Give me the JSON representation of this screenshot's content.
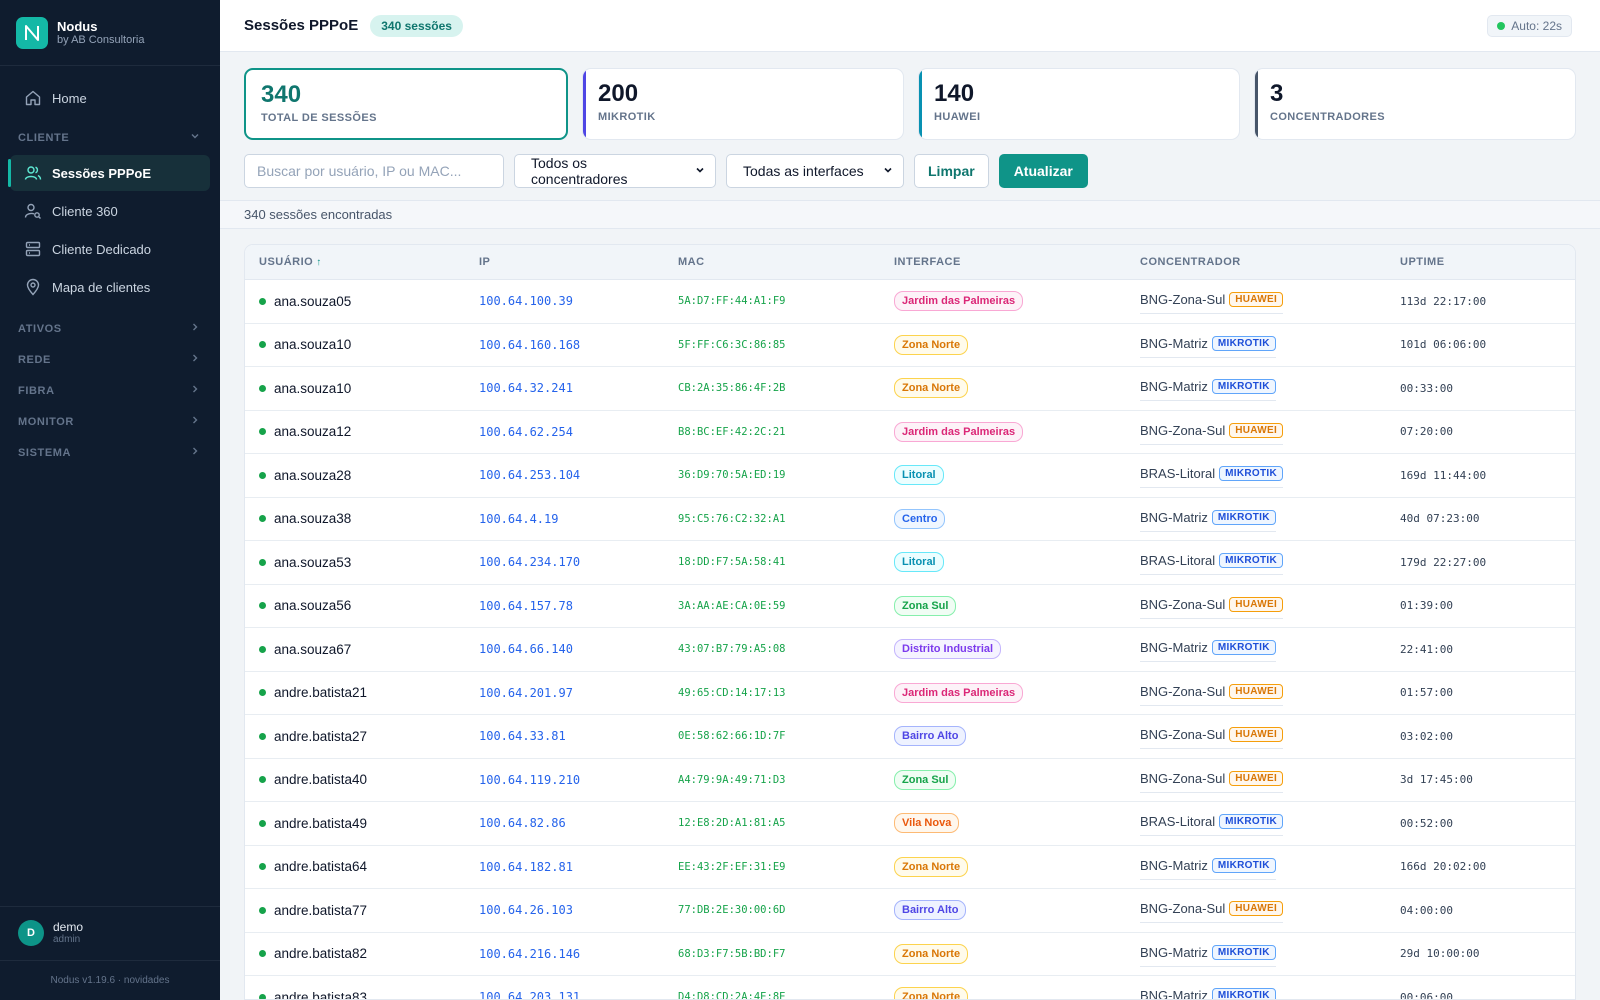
{
  "brand": {
    "name": "Nodus",
    "subtitle": "by AB Consultoria",
    "logo_letter": "N"
  },
  "sidebar": {
    "items_top": [
      {
        "label": "Home",
        "icon": "home-icon"
      }
    ],
    "cliente_section": "CLIENTE",
    "cliente_items": [
      {
        "label": "Sessões PPPoE",
        "icon": "users-icon",
        "active": true
      },
      {
        "label": "Cliente 360",
        "icon": "user-search-icon"
      },
      {
        "label": "Cliente Dedicado",
        "icon": "server-icon"
      },
      {
        "label": "Mapa de clientes",
        "icon": "map-pin-icon"
      }
    ],
    "sections": [
      "ATIVOS",
      "REDE",
      "FIBRA",
      "MONITOR",
      "SISTEMA"
    ]
  },
  "user": {
    "initial": "D",
    "name": "demo",
    "role": "admin"
  },
  "version": "Nodus v1.19.6 · novidades",
  "header": {
    "title": "Sessões PPPoE",
    "count_pill": "340 sessões",
    "auto": "Auto: 22s"
  },
  "stats": [
    {
      "value": "340",
      "label": "TOTAL DE SESSÕES"
    },
    {
      "value": "200",
      "label": "MIKROTIK"
    },
    {
      "value": "140",
      "label": "HUAWEI"
    },
    {
      "value": "3",
      "label": "CONCENTRADORES"
    }
  ],
  "filters": {
    "search_placeholder": "Buscar por usuário, IP ou MAC...",
    "concentrator_select": "Todos os concentradores",
    "interface_select": "Todas as interfaces",
    "clear_label": "Limpar",
    "refresh_label": "Atualizar"
  },
  "results_text": "340 sessões encontradas",
  "table": {
    "columns": [
      "USUÁRIO",
      "IP",
      "MAC",
      "INTERFACE",
      "CONCENTRADOR",
      "UPTIME"
    ],
    "rows": [
      {
        "user": "ana.souza05",
        "ip": "100.64.100.39",
        "mac": "5A:D7:FF:44:A1:F9",
        "iface": "Jardim das Palmeiras",
        "conc": "BNG-Zona-Sul",
        "vendor": "HUAWEI",
        "uptime": "113d 22:17:00"
      },
      {
        "user": "ana.souza10",
        "ip": "100.64.160.168",
        "mac": "5F:FF:C6:3C:86:85",
        "iface": "Zona Norte",
        "conc": "BNG-Matriz",
        "vendor": "MIKROTIK",
        "uptime": "101d 06:06:00"
      },
      {
        "user": "ana.souza10",
        "ip": "100.64.32.241",
        "mac": "CB:2A:35:86:4F:2B",
        "iface": "Zona Norte",
        "conc": "BNG-Matriz",
        "vendor": "MIKROTIK",
        "uptime": "00:33:00"
      },
      {
        "user": "ana.souza12",
        "ip": "100.64.62.254",
        "mac": "B8:BC:EF:42:2C:21",
        "iface": "Jardim das Palmeiras",
        "conc": "BNG-Zona-Sul",
        "vendor": "HUAWEI",
        "uptime": "07:20:00"
      },
      {
        "user": "ana.souza28",
        "ip": "100.64.253.104",
        "mac": "36:D9:70:5A:ED:19",
        "iface": "Litoral",
        "conc": "BRAS-Litoral",
        "vendor": "MIKROTIK",
        "uptime": "169d 11:44:00"
      },
      {
        "user": "ana.souza38",
        "ip": "100.64.4.19",
        "mac": "95:C5:76:C2:32:A1",
        "iface": "Centro",
        "conc": "BNG-Matriz",
        "vendor": "MIKROTIK",
        "uptime": "40d 07:23:00"
      },
      {
        "user": "ana.souza53",
        "ip": "100.64.234.170",
        "mac": "18:DD:F7:5A:58:41",
        "iface": "Litoral",
        "conc": "BRAS-Litoral",
        "vendor": "MIKROTIK",
        "uptime": "179d 22:27:00"
      },
      {
        "user": "ana.souza56",
        "ip": "100.64.157.78",
        "mac": "3A:AA:AE:CA:0E:59",
        "iface": "Zona Sul",
        "conc": "BNG-Zona-Sul",
        "vendor": "HUAWEI",
        "uptime": "01:39:00"
      },
      {
        "user": "ana.souza67",
        "ip": "100.64.66.140",
        "mac": "43:07:B7:79:A5:08",
        "iface": "Distrito Industrial",
        "conc": "BNG-Matriz",
        "vendor": "MIKROTIK",
        "uptime": "22:41:00"
      },
      {
        "user": "andre.batista21",
        "ip": "100.64.201.97",
        "mac": "49:65:CD:14:17:13",
        "iface": "Jardim das Palmeiras",
        "conc": "BNG-Zona-Sul",
        "vendor": "HUAWEI",
        "uptime": "01:57:00"
      },
      {
        "user": "andre.batista27",
        "ip": "100.64.33.81",
        "mac": "0E:58:62:66:1D:7F",
        "iface": "Bairro Alto",
        "conc": "BNG-Zona-Sul",
        "vendor": "HUAWEI",
        "uptime": "03:02:00"
      },
      {
        "user": "andre.batista40",
        "ip": "100.64.119.210",
        "mac": "A4:79:9A:49:71:D3",
        "iface": "Zona Sul",
        "conc": "BNG-Zona-Sul",
        "vendor": "HUAWEI",
        "uptime": "3d 17:45:00"
      },
      {
        "user": "andre.batista49",
        "ip": "100.64.82.86",
        "mac": "12:E8:2D:A1:81:A5",
        "iface": "Vila Nova",
        "conc": "BRAS-Litoral",
        "vendor": "MIKROTIK",
        "uptime": "00:52:00"
      },
      {
        "user": "andre.batista64",
        "ip": "100.64.182.81",
        "mac": "EE:43:2F:EF:31:E9",
        "iface": "Zona Norte",
        "conc": "BNG-Matriz",
        "vendor": "MIKROTIK",
        "uptime": "166d 20:02:00"
      },
      {
        "user": "andre.batista77",
        "ip": "100.64.26.103",
        "mac": "77:DB:2E:30:00:6D",
        "iface": "Bairro Alto",
        "conc": "BNG-Zona-Sul",
        "vendor": "HUAWEI",
        "uptime": "04:00:00"
      },
      {
        "user": "andre.batista82",
        "ip": "100.64.216.146",
        "mac": "68:D3:F7:5B:BD:F7",
        "iface": "Zona Norte",
        "conc": "BNG-Matriz",
        "vendor": "MIKROTIK",
        "uptime": "29d 10:00:00"
      },
      {
        "user": "andre.batista83",
        "ip": "100.64.203.131",
        "mac": "D4:D8:CD:2A:4E:8E",
        "iface": "Zona Norte",
        "conc": "BNG-Matriz",
        "vendor": "MIKROTIK",
        "uptime": "00:06:00"
      }
    ]
  },
  "colors": {
    "accent": "#0f9488",
    "sidebar_bg": "#0f1c2e",
    "iface": {
      "Jardim das Palmeiras": [
        "#db2777",
        "#fdf2f8",
        "#f9a8d4"
      ],
      "Zona Norte": [
        "#d97706",
        "#fffbeb",
        "#fcd34d"
      ],
      "Litoral": [
        "#0891b2",
        "#ecfeff",
        "#67e8f9"
      ],
      "Centro": [
        "#2563eb",
        "#eff6ff",
        "#93c5fd"
      ],
      "Zona Sul": [
        "#16a34a",
        "#f0fdf4",
        "#86efac"
      ],
      "Distrito Industrial": [
        "#7c3aed",
        "#f5f3ff",
        "#c4b5fd"
      ],
      "Bairro Alto": [
        "#4f46e5",
        "#eef2ff",
        "#a5b4fc"
      ],
      "Vila Nova": [
        "#ea580c",
        "#fff7ed",
        "#fdba74"
      ]
    }
  }
}
